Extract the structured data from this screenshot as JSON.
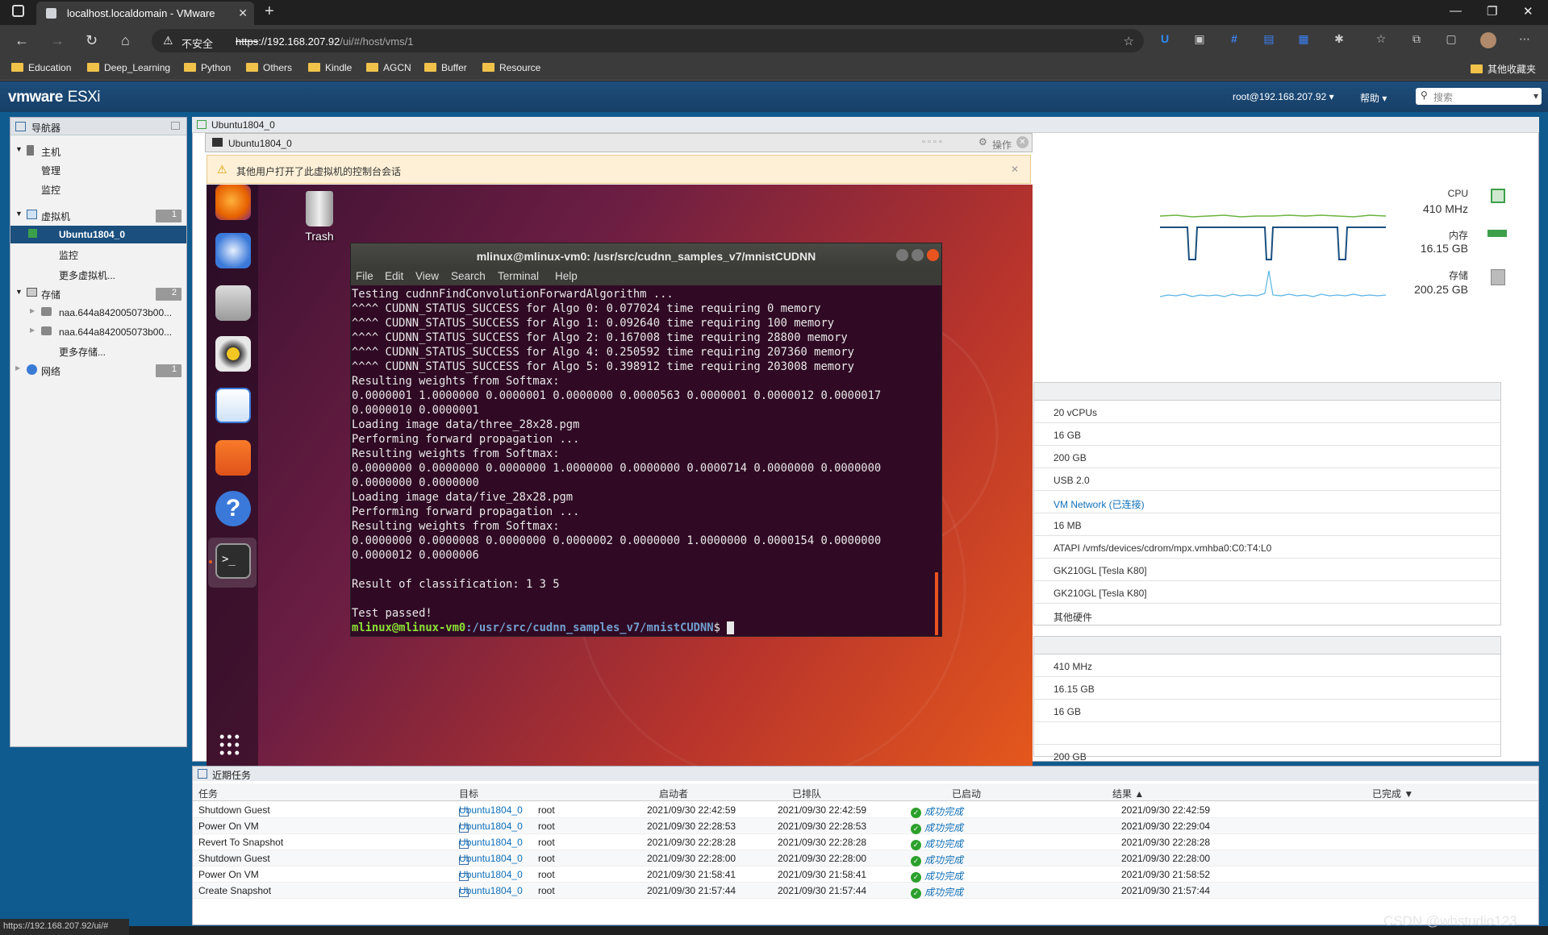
{
  "browser": {
    "tab_title": "localhost.localdomain - VMware",
    "insecure_label": "不安全",
    "url_scheme": "https",
    "url_rest": "://192.168.207.92",
    "url_path": "/ui/#/host/vms/1",
    "bookmarks": [
      "Education",
      "Deep_Learning",
      "Python",
      "Others",
      "Kindle",
      "AGCN",
      "Buffer",
      "Resource"
    ],
    "other_bookmarks": "其他收藏夹",
    "status_url": "https://192.168.207.92/ui/#"
  },
  "esxi": {
    "logo": "vmware",
    "product": "ESXi",
    "user": "root@192.168.207.92",
    "help": "帮助",
    "search_placeholder": "搜索"
  },
  "navigator": {
    "title": "导航器",
    "host": "主机",
    "manage": "管理",
    "monitor": "监控",
    "vms": "虚拟机",
    "vms_count": "1",
    "vm_selected": "Ubuntu1804_0",
    "vm_monitor": "监控",
    "more_vms": "更多虚拟机...",
    "storage": "存储",
    "storage_count": "2",
    "storage_items": [
      "naa.644a842005073b00...",
      "naa.644a842005073b00..."
    ],
    "more_storage": "更多存储...",
    "network": "网络",
    "network_count": "1"
  },
  "main": {
    "tab": "Ubuntu1804_0",
    "console_title": "Ubuntu1804_0",
    "actions": "操作",
    "warning": "其他用户打开了此虚拟机的控制台会话"
  },
  "stats": {
    "cpu_label": "CPU",
    "cpu_value": "410 MHz",
    "mem_label": "内存",
    "mem_value": "16.15 GB",
    "storage_label": "存储",
    "storage_value": "200.25 GB"
  },
  "hardware": [
    "20 vCPUs",
    "16 GB",
    "200 GB",
    "USB 2.0",
    "VM Network (已连接)",
    "16 MB",
    "ATAPI /vmfs/devices/cdrom/mpx.vmhba0:C0:T4:L0",
    "GK210GL [Tesla K80]",
    "GK210GL [Tesla K80]",
    "其他硬件"
  ],
  "resources": [
    "410 MHz",
    "16.15 GB",
    "16 GB",
    "",
    "200 GB"
  ],
  "ubuntu": {
    "trash": "Trash",
    "terminal_title": "mlinux@mlinux-vm0: /usr/src/cudnn_samples_v7/mnistCUDNN",
    "menu": [
      "File",
      "Edit",
      "View",
      "Search",
      "Terminal",
      "Help"
    ],
    "lines": [
      "Testing cudnnFindConvolutionForwardAlgorithm ...",
      "^^^^ CUDNN_STATUS_SUCCESS for Algo 0: 0.077024 time requiring 0 memory",
      "^^^^ CUDNN_STATUS_SUCCESS for Algo 1: 0.092640 time requiring 100 memory",
      "^^^^ CUDNN_STATUS_SUCCESS for Algo 2: 0.167008 time requiring 28800 memory",
      "^^^^ CUDNN_STATUS_SUCCESS for Algo 4: 0.250592 time requiring 207360 memory",
      "^^^^ CUDNN_STATUS_SUCCESS for Algo 5: 0.398912 time requiring 203008 memory",
      "Resulting weights from Softmax:",
      "0.0000001 1.0000000 0.0000001 0.0000000 0.0000563 0.0000001 0.0000012 0.0000017",
      "0.0000010 0.0000001",
      "Loading image data/three_28x28.pgm",
      "Performing forward propagation ...",
      "Resulting weights from Softmax:",
      "0.0000000 0.0000000 0.0000000 1.0000000 0.0000000 0.0000714 0.0000000 0.0000000",
      "0.0000000 0.0000000",
      "Loading image data/five_28x28.pgm",
      "Performing forward propagation ...",
      "Resulting weights from Softmax:",
      "0.0000000 0.0000008 0.0000000 0.0000002 0.0000000 1.0000000 0.0000154 0.0000000",
      "0.0000012 0.0000006",
      "",
      "Result of classification: 1 3 5",
      "",
      "Test passed!"
    ],
    "prompt_user": "mlinux@mlinux-vm0",
    "prompt_path": ":/usr/src/cudnn_samples_v7/mnistCUDNN",
    "prompt_end": "$"
  },
  "tasks": {
    "title": "近期任务",
    "columns": [
      "任务",
      "目标",
      "启动者",
      "已排队",
      "已启动",
      "结果 ▲",
      "已完成 ▼"
    ],
    "rows": [
      {
        "task": "Shutdown Guest",
        "target": "Ubuntu1804_0",
        "initiator": "root",
        "queued": "2021/09/30 22:42:59",
        "started": "2021/09/30 22:42:59",
        "result": "成功完成",
        "completed": "2021/09/30 22:42:59"
      },
      {
        "task": "Power On VM",
        "target": "Ubuntu1804_0",
        "initiator": "root",
        "queued": "2021/09/30 22:28:53",
        "started": "2021/09/30 22:28:53",
        "result": "成功完成",
        "completed": "2021/09/30 22:29:04"
      },
      {
        "task": "Revert To Snapshot",
        "target": "Ubuntu1804_0",
        "initiator": "root",
        "queued": "2021/09/30 22:28:28",
        "started": "2021/09/30 22:28:28",
        "result": "成功完成",
        "completed": "2021/09/30 22:28:28"
      },
      {
        "task": "Shutdown Guest",
        "target": "Ubuntu1804_0",
        "initiator": "root",
        "queued": "2021/09/30 22:28:00",
        "started": "2021/09/30 22:28:00",
        "result": "成功完成",
        "completed": "2021/09/30 22:28:00"
      },
      {
        "task": "Power On VM",
        "target": "Ubuntu1804_0",
        "initiator": "root",
        "queued": "2021/09/30 21:58:41",
        "started": "2021/09/30 21:58:41",
        "result": "成功完成",
        "completed": "2021/09/30 21:58:52"
      },
      {
        "task": "Create Snapshot",
        "target": "Ubuntu1804_0",
        "initiator": "root",
        "queued": "2021/09/30 21:57:44",
        "started": "2021/09/30 21:57:44",
        "result": "成功完成",
        "completed": "2021/09/30 21:57:44"
      }
    ]
  },
  "watermark": "CSDN @whstudio123"
}
